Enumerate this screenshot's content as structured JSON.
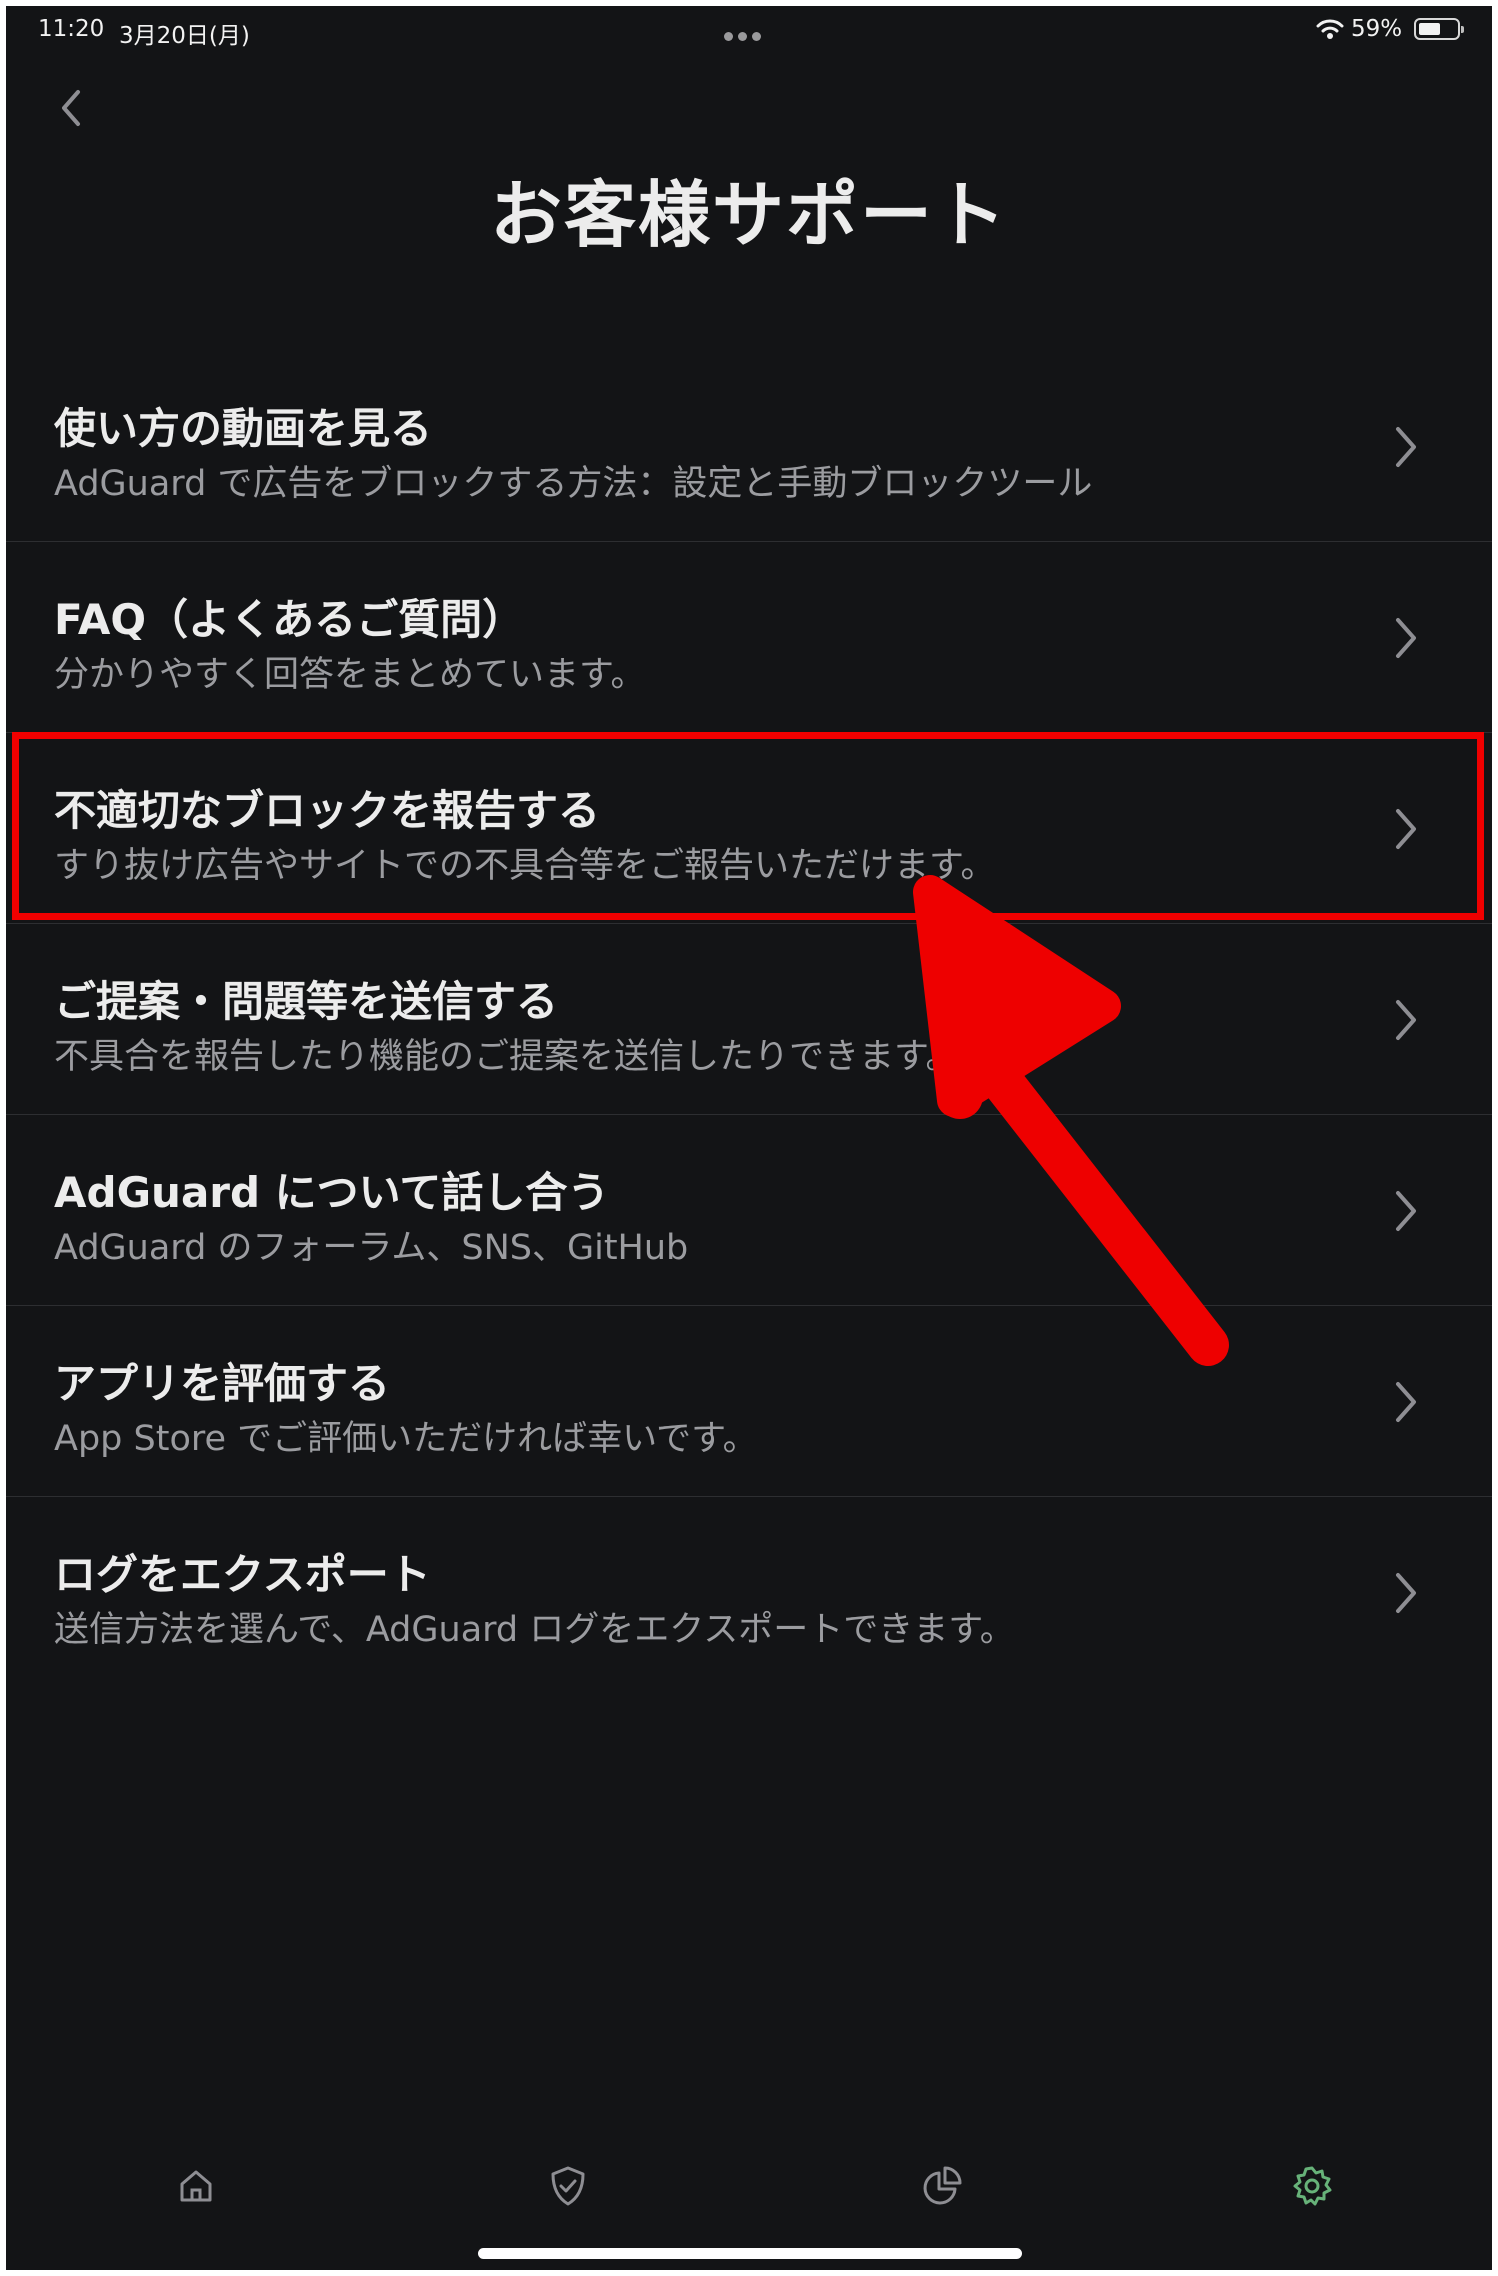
{
  "status_bar": {
    "time": "11:20",
    "date": "3月20日(月)",
    "battery_percent": "59%",
    "battery_level": 0.59
  },
  "header": {
    "title": "お客様サポート"
  },
  "menu": [
    {
      "label": "使い方の動画を見る",
      "subtitle": "AdGuard で広告をブロックする方法：設定と手動ブロックツール"
    },
    {
      "label": "FAQ（よくあるご質問）",
      "subtitle": "分かりやすく回答をまとめています。"
    },
    {
      "label": "不適切なブロックを報告する",
      "subtitle": "すり抜け広告やサイトでの不具合等をご報告いただけます。"
    },
    {
      "label": "ご提案・問題等を送信する",
      "subtitle": "不具合を報告したり機能のご提案を送信したりできます。"
    },
    {
      "label": "AdGuard について話し合う",
      "subtitle": "AdGuard のフォーラム、SNS、GitHub"
    },
    {
      "label": "アプリを評価する",
      "subtitle": "App Store でご評価いただければ幸いです。"
    },
    {
      "label": "ログをエクスポート",
      "subtitle": "送信方法を選んで、AdGuard ログをエクスポートできます。"
    }
  ],
  "highlighted_item_index": 2,
  "annotation_color": "#f00000",
  "tabs": [
    {
      "icon": "home-icon",
      "active": false
    },
    {
      "icon": "shield-check-icon",
      "active": false
    },
    {
      "icon": "pie-chart-icon",
      "active": false
    },
    {
      "icon": "gear-icon",
      "active": true
    }
  ],
  "colors": {
    "background": "#131416",
    "active_tab": "#67b279",
    "text": "#ececec",
    "subtext": "#9b9ca0"
  }
}
